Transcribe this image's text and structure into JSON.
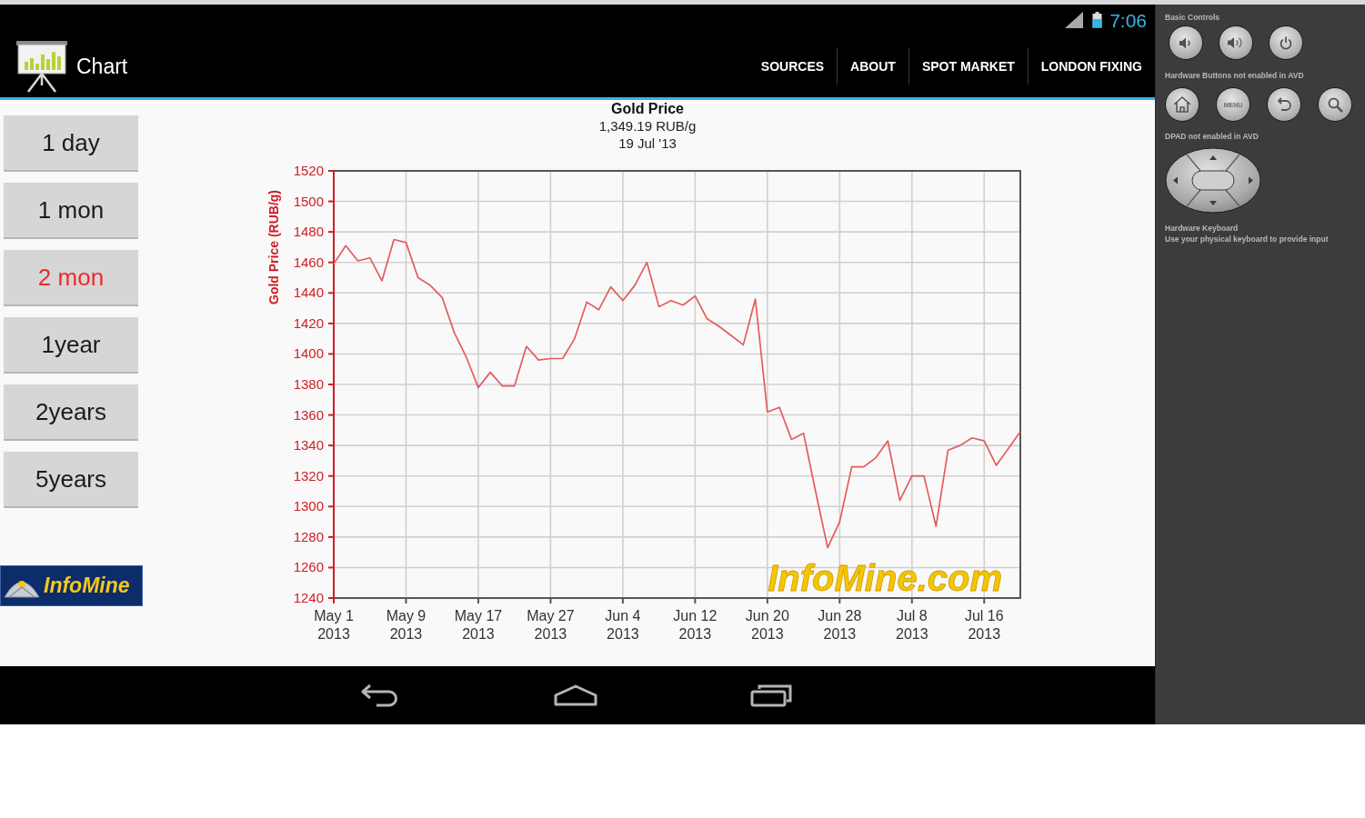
{
  "status_bar": {
    "time": "7:06"
  },
  "action_bar": {
    "title": "Chart",
    "actions": [
      "SOURCES",
      "ABOUT",
      "SPOT MARKET",
      "LONDON FIXING"
    ]
  },
  "periods": [
    {
      "label": "1 day",
      "selected": false
    },
    {
      "label": "1 mon",
      "selected": false
    },
    {
      "label": "2 mon",
      "selected": true
    },
    {
      "label": "1year",
      "selected": false
    },
    {
      "label": "2years",
      "selected": false
    },
    {
      "label": "5years",
      "selected": false
    }
  ],
  "logo": {
    "text": "InfoMine"
  },
  "chart": {
    "chart_data": [
      {
        "type": "line",
        "title": "Gold Price",
        "subtitle": "1,349.19 RUB/g\n19 Jul '13",
        "ylabel": "Gold Price (RUB/g)",
        "categories": [
          "May 1\n2013",
          null,
          null,
          null,
          null,
          null,
          "May 9\n2013",
          null,
          null,
          null,
          null,
          null,
          "May 17\n2013",
          null,
          null,
          null,
          null,
          null,
          "May 27\n2013",
          null,
          null,
          null,
          null,
          null,
          "Jun 4\n2013",
          null,
          null,
          null,
          null,
          null,
          "Jun 12\n2013",
          null,
          null,
          null,
          null,
          null,
          "Jun 20\n2013",
          null,
          null,
          null,
          null,
          null,
          "Jun 28\n2013",
          null,
          null,
          null,
          null,
          null,
          "Jul 8\n2013",
          null,
          null,
          null,
          null,
          null,
          "Jul 16\n2013",
          null,
          null,
          null
        ],
        "values": [
          1459,
          1471,
          1461,
          1463,
          1448,
          1475,
          1473,
          1450,
          1445,
          1437,
          1414,
          1398,
          1378,
          1388,
          1379,
          1379,
          1405,
          1396,
          1397,
          1397,
          1410,
          1434,
          1429,
          1444,
          1435,
          1445,
          1460,
          1431,
          1435,
          1432,
          1438,
          1423,
          1418,
          1412,
          1406,
          1436,
          1362,
          1365,
          1344,
          1348,
          1310,
          1273,
          1290,
          1326,
          1326,
          1332,
          1343,
          1304,
          1320,
          1320,
          1287,
          1337,
          1340,
          1345,
          1343,
          1327,
          1338,
          1349
        ],
        "color": "#e55b5b",
        "ylim": [
          1240,
          1520
        ],
        "yticks": [
          1240,
          1260,
          1280,
          1300,
          1320,
          1340,
          1360,
          1380,
          1400,
          1420,
          1440,
          1460,
          1480,
          1500,
          1520
        ],
        "grid": true,
        "annotations": [
          "InfoMine.com"
        ]
      }
    ]
  },
  "emulator_panel": {
    "basic_controls_label": "Basic Controls",
    "hardware_buttons_label": "Hardware Buttons not enabled in AVD",
    "menu_button_label": "MENU",
    "dpad_label": "DPAD not enabled in AVD",
    "keyboard_title": "Hardware Keyboard",
    "keyboard_hint": "Use your physical keyboard to provide input"
  }
}
